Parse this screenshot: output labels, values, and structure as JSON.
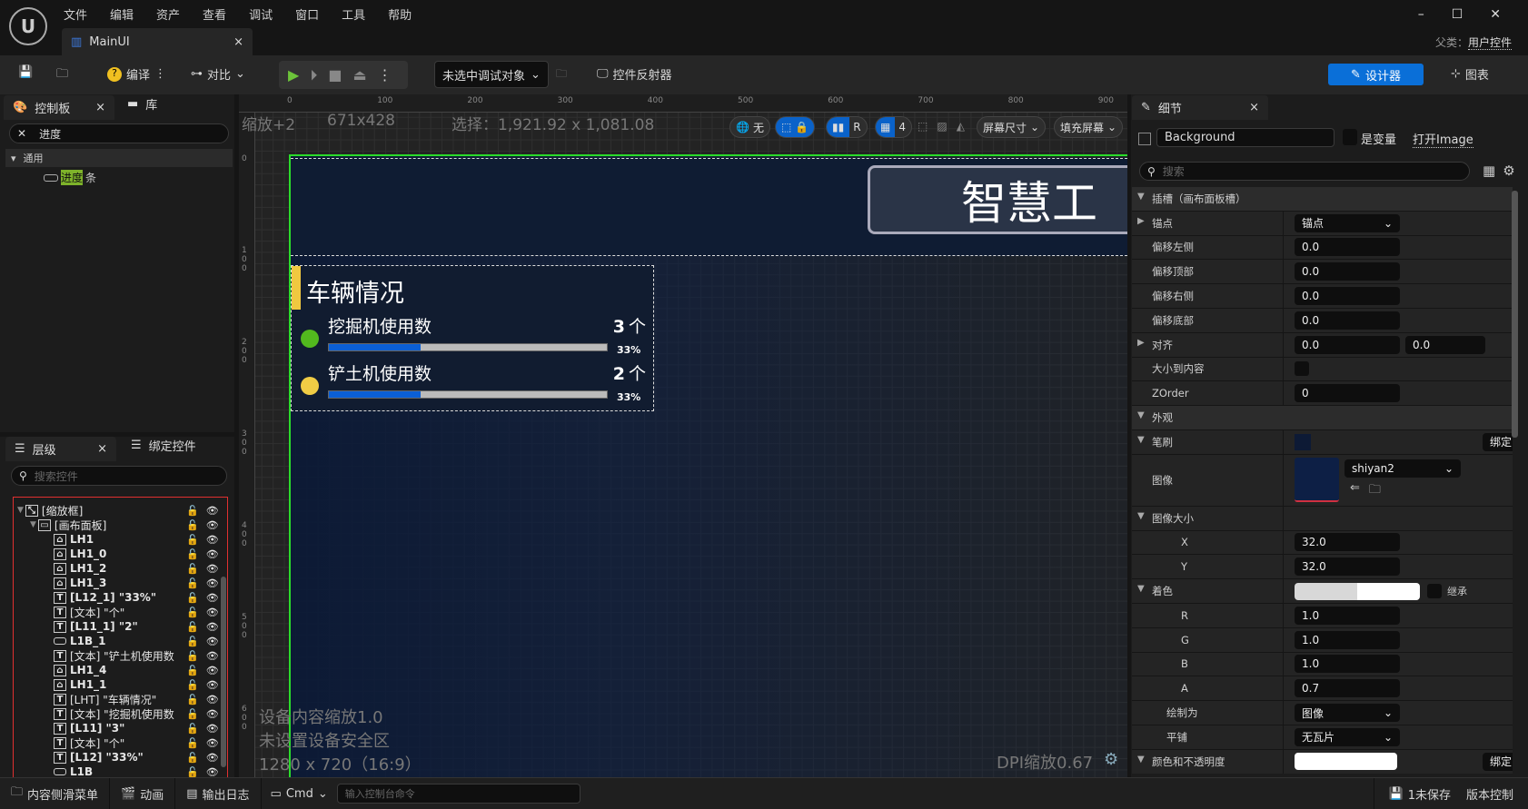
{
  "menu": [
    "文件",
    "编辑",
    "资产",
    "查看",
    "调试",
    "窗口",
    "工具",
    "帮助"
  ],
  "doc_tab": "MainUI",
  "parent_label": "父类：",
  "parent_value": "用户控件",
  "toolbar": {
    "compile": "编译",
    "diff": "对比",
    "debug_target": "未选中调试对象",
    "widget_reflector": "控件反射器",
    "designer": "设计器",
    "graph": "图表"
  },
  "palette": {
    "tab": "控制板",
    "library_tab": "库",
    "search_value": "进度",
    "category": "通用",
    "item_prefix": "进度",
    "item_suffix": "条"
  },
  "hierarchy": {
    "tab": "层级",
    "bind_tab": "绑定控件",
    "search_placeholder": "搜索控件",
    "items": [
      {
        "label": "[缩放框]",
        "icon": "scale-box",
        "depth": 0,
        "expanded": true
      },
      {
        "label": "[画布面板]",
        "icon": "canvas",
        "depth": 1,
        "expanded": true
      },
      {
        "label": "LH1",
        "icon": "image",
        "depth": 2
      },
      {
        "label": "LH1_0",
        "icon": "image",
        "depth": 2
      },
      {
        "label": "LH1_2",
        "icon": "image",
        "depth": 2
      },
      {
        "label": "LH1_3",
        "icon": "image",
        "depth": 2
      },
      {
        "label": "[L12_1] \"33%\"",
        "icon": "text",
        "depth": 2
      },
      {
        "label": "[文本] \"个\"",
        "icon": "text",
        "depth": 2
      },
      {
        "label": "[L11_1] \"2\"",
        "icon": "text",
        "depth": 2
      },
      {
        "label": "L1B_1",
        "icon": "progress",
        "depth": 2
      },
      {
        "label": "[文本] \"铲土机使用数",
        "icon": "text",
        "depth": 2
      },
      {
        "label": "LH1_4",
        "icon": "image",
        "depth": 2
      },
      {
        "label": "LH1_1",
        "icon": "image",
        "depth": 2
      },
      {
        "label": "[LHT] \"车辆情况\"",
        "icon": "text",
        "depth": 2
      },
      {
        "label": "[文本] \"挖掘机使用数",
        "icon": "text",
        "depth": 2
      },
      {
        "label": "[L11] \"3\"",
        "icon": "text",
        "depth": 2
      },
      {
        "label": "[文本] \"个\"",
        "icon": "text",
        "depth": 2
      },
      {
        "label": "[L12] \"33%\"",
        "icon": "text",
        "depth": 2
      },
      {
        "label": "L1B",
        "icon": "progress",
        "depth": 2
      }
    ]
  },
  "canvas": {
    "zoom": "缩放+2",
    "size": "671x428",
    "selection": "选择：1,921.92 x 1,081.08",
    "ruler_x": [
      "0",
      "100",
      "200",
      "300",
      "400",
      "500",
      "600",
      "700",
      "800",
      "900"
    ],
    "ruler_y": [
      "0",
      "100",
      "200",
      "300",
      "400",
      "500",
      "600"
    ],
    "buttons": {
      "none": "无",
      "r": "R",
      "grid": "4",
      "screen_size": "屏幕尺寸",
      "fill_screen": "填充屏幕"
    },
    "device_scale": "设备内容缩放1.0",
    "safe_zone": "未设置设备安全区",
    "resolution": "1280 x 720（16:9）",
    "dpi": "DPI缩放0.67",
    "title": "智慧工",
    "panel_title": "车辆情况",
    "rows": [
      {
        "label": "挖掘机使用数",
        "count": "3",
        "unit": "个",
        "percent": "33%",
        "progress": 0.33,
        "dot": "#52b81e"
      },
      {
        "label": "铲土机使用数",
        "count": "2",
        "unit": "个",
        "percent": "33%",
        "progress": 0.33,
        "dot": "#f0cc45"
      }
    ]
  },
  "details": {
    "tab": "细节",
    "name": "Background",
    "is_variable": "是变量",
    "open": "打开Image",
    "search_placeholder": "搜索",
    "rows": [
      {
        "label": "插槽（画布面板槽）",
        "type": "section"
      },
      {
        "label": "锚点",
        "type": "dropdown",
        "value": "锚点",
        "arrow": true,
        "reset": true
      },
      {
        "label": "偏移左侧",
        "value": "0.0",
        "key": true
      },
      {
        "label": "偏移顶部",
        "value": "0.0",
        "key": true
      },
      {
        "label": "偏移右侧",
        "value": "0.0",
        "reset": true,
        "key": true
      },
      {
        "label": "偏移底部",
        "value": "0.0",
        "reset": true,
        "key": true
      },
      {
        "label": "对齐",
        "value": "0.0",
        "value2": "0.0",
        "arrow": true,
        "key": true
      },
      {
        "label": "大小到内容",
        "type": "check",
        "key": true
      },
      {
        "label": "ZOrder",
        "value": "0",
        "key": true
      },
      {
        "label": "外观",
        "type": "section"
      },
      {
        "label": "笔刷",
        "type": "brush",
        "bind": "绑定",
        "reset": true
      },
      {
        "label": "图像",
        "type": "image",
        "value": "shiyan2",
        "reset": true
      },
      {
        "label": "图像大小",
        "type": "sub",
        "reset": true
      },
      {
        "label": "X",
        "value": "32.0",
        "reset": true,
        "indent": 2
      },
      {
        "label": "Y",
        "value": "32.0",
        "reset": true,
        "indent": 2
      },
      {
        "label": "着色",
        "type": "tint",
        "inherit": "继承",
        "reset": true
      },
      {
        "label": "R",
        "value": "1.0",
        "indent": 2
      },
      {
        "label": "G",
        "value": "1.0",
        "indent": 2
      },
      {
        "label": "B",
        "value": "1.0",
        "indent": 2
      },
      {
        "label": "A",
        "value": "0.7",
        "reset": true,
        "indent": 2
      },
      {
        "label": "绘制为",
        "type": "dropdown",
        "value": "图像",
        "indent": 1
      },
      {
        "label": "平铺",
        "type": "dropdown",
        "value": "无瓦片",
        "indent": 1
      },
      {
        "label": "颜色和不透明度",
        "type": "color",
        "bind": "绑定",
        "key": true
      }
    ]
  },
  "bottom": {
    "content_drawer": "内容侧滑菜单",
    "animation": "动画",
    "output_log": "输出日志",
    "cmd": "Cmd",
    "cmd_placeholder": "输入控制台命令",
    "unsaved": "1未保存",
    "source_control": "版本控制"
  }
}
